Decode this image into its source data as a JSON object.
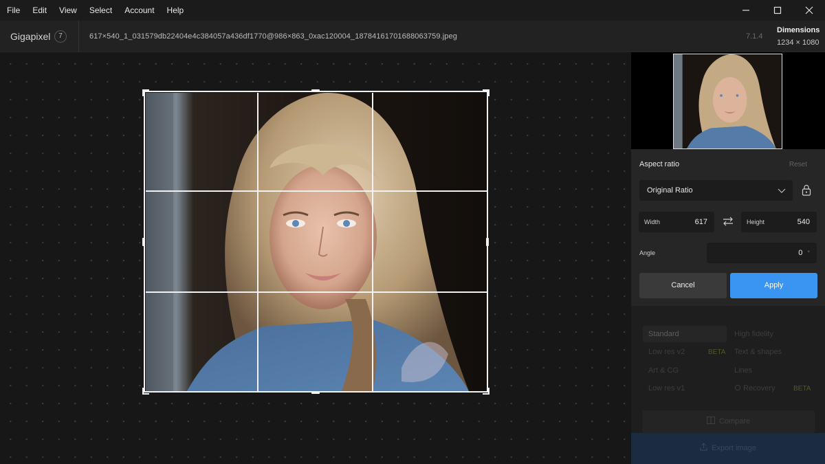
{
  "menu": {
    "items": [
      "File",
      "Edit",
      "View",
      "Select",
      "Account",
      "Help"
    ]
  },
  "window_controls": {
    "minimize_icon": "minimize-icon",
    "maximize_icon": "maximize-icon",
    "close_icon": "close-icon"
  },
  "header": {
    "app_name": "Gigapixel",
    "badge": "7",
    "file_name": "617×540_1_031579db22404e4c384057a436df1770@986×863_0xac120004_18784161701688063759.jpeg",
    "version": "7.1.4",
    "dimensions_label": "Dimensions",
    "dimensions_value": "1234 × 1080"
  },
  "crop": {
    "aspect_label": "Aspect ratio",
    "reset_label": "Reset",
    "ratio_value": "Original Ratio",
    "width_label": "Width",
    "width_value": "617",
    "height_label": "Height",
    "height_value": "540",
    "angle_label": "Angle",
    "angle_value": "0",
    "angle_unit": "°",
    "cancel_label": "Cancel",
    "apply_label": "Apply"
  },
  "models": {
    "standard": "Standard",
    "high_fidelity": "High fidelity",
    "low_res_v2": "Low res v2",
    "beta_1": "BETA",
    "text_shapes": "Text & shapes",
    "art_cg": "Art & CG",
    "lines": "Lines",
    "low_res_v1": "Low res v1",
    "recovery": "Recovery",
    "beta_2": "BETA"
  },
  "actions": {
    "compare_label": "Compare",
    "export_label": "Export image"
  },
  "colors": {
    "accent": "#3a95f2",
    "background": "#171717",
    "panel": "#262626"
  }
}
